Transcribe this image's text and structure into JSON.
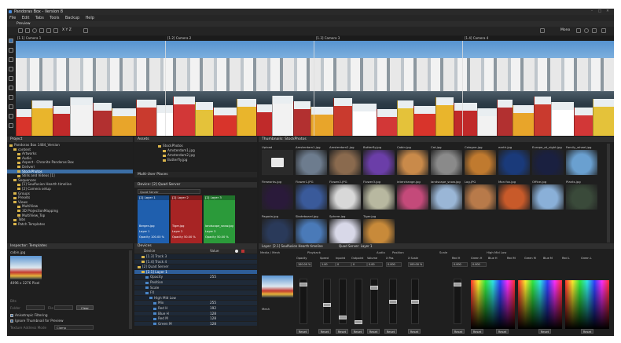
{
  "window": {
    "title": "Pandoras Box - Version 8"
  },
  "menu": [
    "File",
    "Edit",
    "Tabs",
    "Tools",
    "Backup",
    "Help"
  ],
  "tabs": {
    "preview": "Preview"
  },
  "toolbar": {
    "xyz": "X Y Z",
    "view_mode": "Mono"
  },
  "cameras": [
    "[1.1] Camera 1",
    "[1.2] Camera 2",
    "[1.3] Camera 3",
    "[1.4] Camera 4"
  ],
  "project": {
    "title": "Project",
    "items": [
      {
        "label": "Pandoras Box 1484_Version",
        "indent": 0
      },
      {
        "label": "content",
        "indent": 1
      },
      {
        "label": "Artworks",
        "indent": 2
      },
      {
        "label": "Audio",
        "indent": 2
      },
      {
        "label": "Aspect - Chronite Pandoras Box",
        "indent": 2
      },
      {
        "label": "Deliveri",
        "indent": 2
      },
      {
        "label": "StockPhotos",
        "indent": 2,
        "selected": true
      },
      {
        "label": "Stills and Videos [1]",
        "indent": 2
      },
      {
        "label": "Sequences",
        "indent": 1
      },
      {
        "label": "[1] Soulfusion Hearth timeline",
        "indent": 2
      },
      {
        "label": "[2] Camera setup",
        "indent": 2
      },
      {
        "label": "Groups",
        "indent": 1
      },
      {
        "label": "Presets",
        "indent": 1
      },
      {
        "label": "Views",
        "indent": 1
      },
      {
        "label": "MultiView",
        "indent": 2
      },
      {
        "label": "3D ProjectionMapping",
        "indent": 2
      },
      {
        "label": "MultiView_Top",
        "indent": 2
      },
      {
        "label": "Tabs",
        "indent": 1
      },
      {
        "label": "Patch Templates",
        "indent": 1
      }
    ]
  },
  "assets": {
    "title": "Assets",
    "items": [
      "StockPhotos",
      "Amsterdam1.jpg",
      "Amsterdam2.jpg",
      "Butterfly.jpg"
    ],
    "footer": "Multi-User Places"
  },
  "device_panel": {
    "title": "Device: [2] Quad Server",
    "dropdown": "Quad Server",
    "layers": [
      {
        "head": "[2] Layer 1",
        "name": "Bergen.jpg",
        "sub": "Layer 1",
        "opacity": "Opacity 100.00 %",
        "color": "#1f5fae"
      },
      {
        "head": "[2] Layer 2",
        "name": "Tiger.jpg",
        "sub": "Layer 2",
        "opacity": "Opacity 50.00 %",
        "color": "#a72424"
      },
      {
        "head": "[2] Layer 3",
        "name": "landscape_snow.jpg",
        "sub": "Layer 3",
        "opacity": "Opacity 50.00 %",
        "color": "#2b9a3a"
      }
    ]
  },
  "thumbnails": {
    "title": "Thumbnails: StockPhotos",
    "items": [
      {
        "name": "Upload",
        "color": "#2a2a2a",
        "note": "Folder"
      },
      {
        "name": "Amsterdam1.jpg",
        "color": "#6d7c8e"
      },
      {
        "name": "Amsterdam2.jpg",
        "color": "#8a6a4e"
      },
      {
        "name": "Butterfly.jpg",
        "color": "#6b3ea8"
      },
      {
        "name": "Cabin.jpg",
        "color": "#c98a4a"
      },
      {
        "name": "Cat.jpg",
        "color": "#8a8a8a"
      },
      {
        "name": "Cologne.jpg",
        "color": "#c07a2f"
      },
      {
        "name": "earth.jpg",
        "color": "#1a3a7a"
      },
      {
        "name": "Europe_at_night.jpg",
        "color": "#1a2040"
      },
      {
        "name": "Family_wheel.jpg",
        "color": "#6aa0d0"
      },
      {
        "name": "Fireworks.jpg",
        "color": "#2a1a3a"
      },
      {
        "name": "Flower1.JPG",
        "color": "#3a5a9a"
      },
      {
        "name": "Flower2.JPG",
        "color": "#d8d8d8"
      },
      {
        "name": "Flower3.jpg",
        "color": "#b8b8a0"
      },
      {
        "name": "interchange.jpg",
        "color": "#c44a7a"
      },
      {
        "name": "landscape_snow.jpg",
        "color": "#9ab6d6"
      },
      {
        "name": "Log.JPG",
        "color": "#b87a4a"
      },
      {
        "name": "Mon fox.jpg",
        "color": "#c85a2a"
      },
      {
        "name": "Office.jpg",
        "color": "#8ab0d8"
      },
      {
        "name": "Plants.jpg",
        "color": "#3a4a3a"
      },
      {
        "name": "Pagoda.jpg",
        "color": "#2a3a5a"
      },
      {
        "name": "Skateboard.jpg",
        "color": "#4a7ab8"
      },
      {
        "name": "Sphere.jpg",
        "color": "#d8d8e8"
      },
      {
        "name": "Tiger.jpg",
        "color": "#c88a3a"
      }
    ],
    "note": "Wv..."
  },
  "inspector": {
    "title": "Inspector: Templates",
    "file": "cabin.jpg",
    "info": "4096 x 3276 Pixel",
    "labels": [
      "Bits",
      "Folder",
      "File"
    ],
    "clear": "Clear",
    "checks": [
      "Anisotropic Filtering",
      "Ignore Thumbnail for Preview"
    ],
    "mode_label": "Texture Address Mode",
    "mode_value": "Clamp"
  },
  "devices": {
    "title": "Devices",
    "headers": [
      "Device",
      "Value"
    ],
    "rows": [
      {
        "label": "[1.3] Track 3",
        "indent": 1
      },
      {
        "label": "[1.4] Track 4",
        "indent": 1
      },
      {
        "label": "[2] Quad Server",
        "indent": 0
      },
      {
        "label": "[2.1] Layer 1",
        "indent": 1,
        "selected": true
      },
      {
        "label": "Opacity",
        "indent": 2,
        "value": "255"
      },
      {
        "label": "Position",
        "indent": 2
      },
      {
        "label": "Scale",
        "indent": 2
      },
      {
        "label": "FX",
        "indent": 2
      },
      {
        "label": "High Mid Low",
        "indent": 3
      },
      {
        "label": "Mix",
        "indent": 4,
        "value": "255"
      },
      {
        "label": "Red H",
        "indent": 4,
        "value": "192"
      },
      {
        "label": "Blue H",
        "indent": 4,
        "value": "128"
      },
      {
        "label": "Red M",
        "indent": 4,
        "value": "128"
      },
      {
        "label": "Green M",
        "indent": 4,
        "value": "128"
      }
    ]
  },
  "layer_panel": {
    "title": "Layer: [2.1] Soulfusion Hearth timeline",
    "device": "Quad Server: Layer 1",
    "sections": [
      "Media / Mesh",
      "Playback",
      "Audio",
      "Position",
      "Scale",
      "High Mid Low"
    ],
    "cols": [
      "Opacity",
      "Speed",
      "Inpoint",
      "Outpoint",
      "Volume",
      "X Pos",
      "X Scale",
      "Red H",
      "Green H",
      "Blue H",
      "Red M",
      "Green M",
      "Blue M",
      "Red L",
      "Green L"
    ],
    "values": [
      "100.00 %",
      "1.00",
      "0",
      "0",
      "0.00",
      "0.000",
      "100.00 %",
      "0.000",
      "0.000"
    ],
    "reset": "Reset",
    "mesh": "Mesh"
  }
}
